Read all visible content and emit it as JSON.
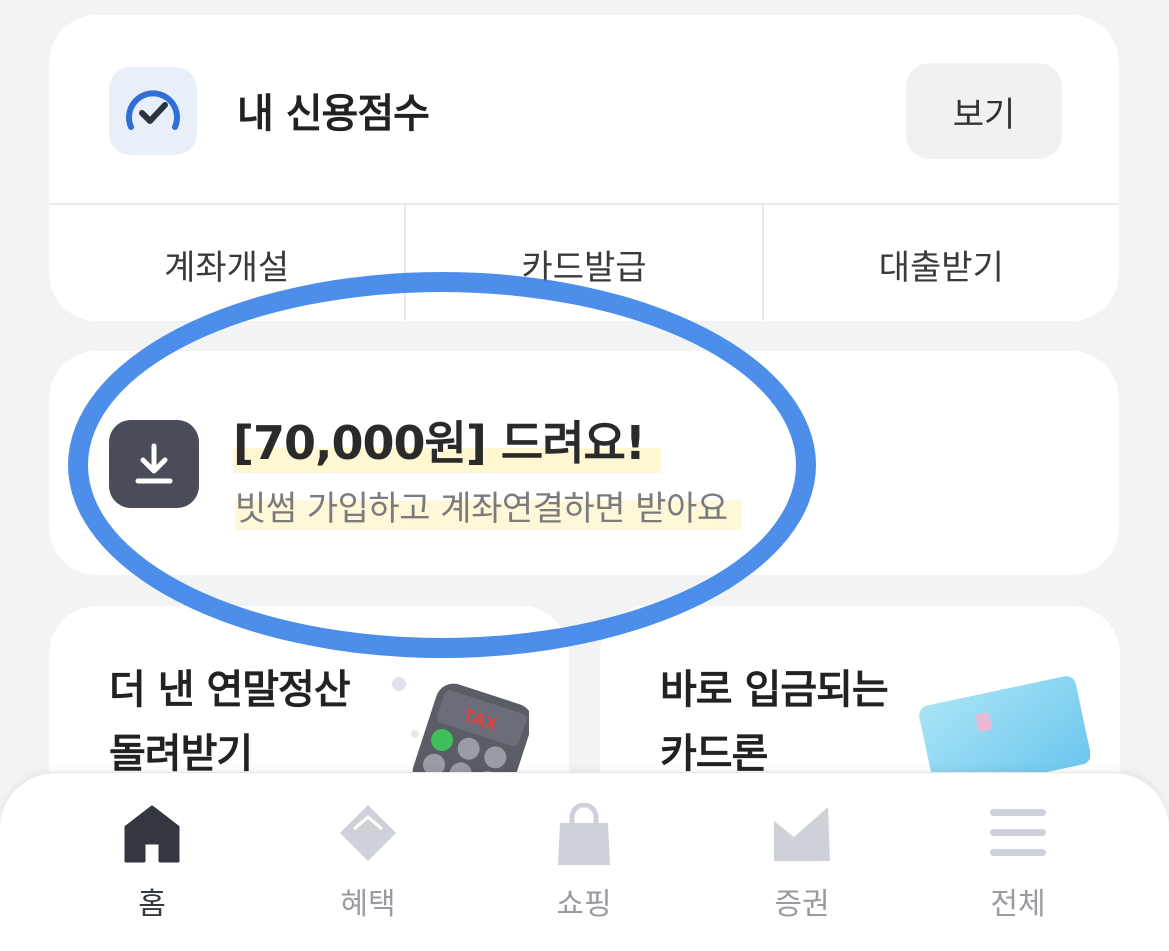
{
  "credit": {
    "title": "내 신용점수",
    "view_button": "보기",
    "icon": "gauge-check-icon"
  },
  "quick_actions": [
    {
      "label": "계좌개설"
    },
    {
      "label": "카드발급"
    },
    {
      "label": "대출받기"
    }
  ],
  "promo": {
    "title": "[70,000원] 드려요!",
    "subtitle": "빗썸 가입하고 계좌연결하면 받아요",
    "icon": "download-icon"
  },
  "features": [
    {
      "line1": "더 낸 연말정산",
      "line2": "돌려받기",
      "art_label": "TAX"
    },
    {
      "line1": "바로 입금되는",
      "line2": "카드론"
    }
  ],
  "bottom_nav": [
    {
      "label": "홈",
      "icon": "home-icon",
      "active": true
    },
    {
      "label": "혜택",
      "icon": "gem-icon",
      "active": false
    },
    {
      "label": "쇼핑",
      "icon": "shopping-bag-icon",
      "active": false
    },
    {
      "label": "증권",
      "icon": "chart-icon",
      "active": false
    },
    {
      "label": "전체",
      "icon": "menu-icon",
      "active": false
    }
  ],
  "colors": {
    "background": "#f2f3f5",
    "annotation": "#3d84e8",
    "highlight": "#fff7d2",
    "icon_dark": "#4a4c59",
    "nav_active": "#333740",
    "nav_inactive": "#cfd1d8"
  }
}
